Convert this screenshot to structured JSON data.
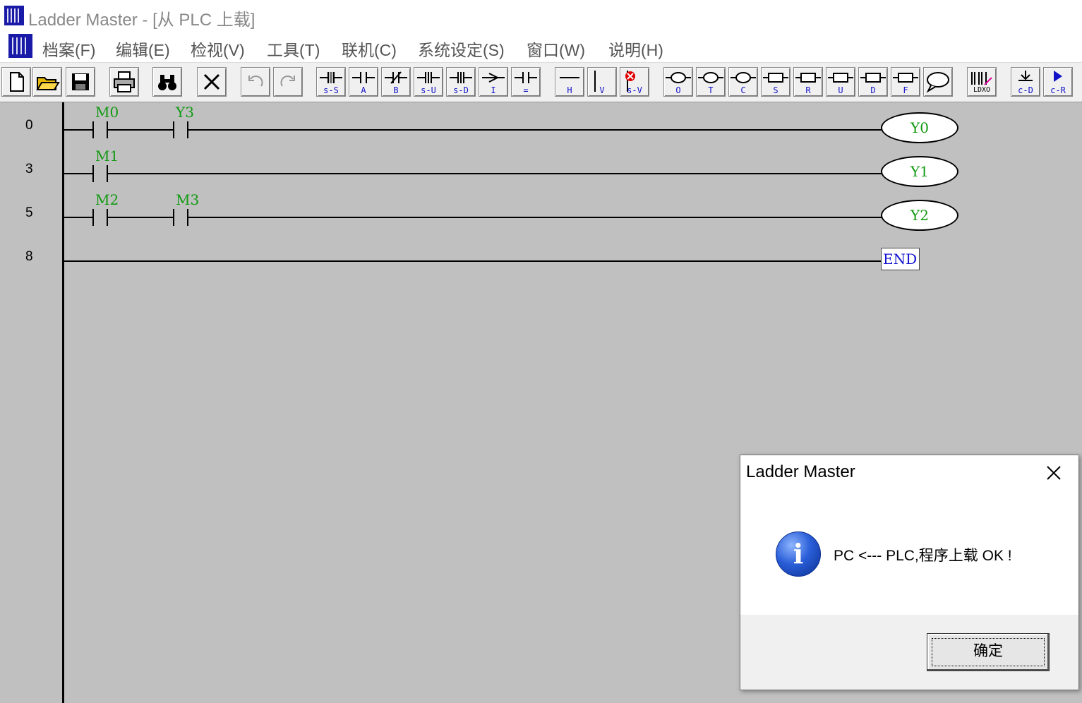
{
  "window": {
    "title": "Ladder Master - [从 PLC 上载]"
  },
  "menu": [
    "档案(F)",
    "编辑(E)",
    "检视(V)",
    "工具(T)",
    "联机(C)",
    "系统设定(S)",
    "窗口(W)",
    "说明(H)"
  ],
  "toolbar": {
    "labels": [
      "s-S",
      "A",
      "B",
      "s-U",
      "s-D",
      "I",
      "=",
      "H",
      "V",
      "s-V",
      "O",
      "T",
      "C",
      "S",
      "R",
      "U",
      "D",
      "F",
      "LDXO",
      "c-D",
      "c-R"
    ]
  },
  "ladder": {
    "rows": [
      {
        "step": "0",
        "contacts": [
          "M0",
          "Y3"
        ],
        "coil": "Y0"
      },
      {
        "step": "3",
        "contacts": [
          "M1"
        ],
        "coil": "Y1"
      },
      {
        "step": "5",
        "contacts": [
          "M2",
          "M3"
        ],
        "coil": "Y2"
      },
      {
        "step": "8",
        "contacts": [],
        "end": "END"
      }
    ]
  },
  "dialog": {
    "title": "Ladder Master",
    "message": "PC <--- PLC,程序上载 OK !",
    "ok_label": "确定"
  },
  "colors": {
    "device_label": "#119911",
    "end_label": "#1212d0",
    "workspace": "#c0c0c0",
    "toolbar_label": "#1212c8"
  }
}
